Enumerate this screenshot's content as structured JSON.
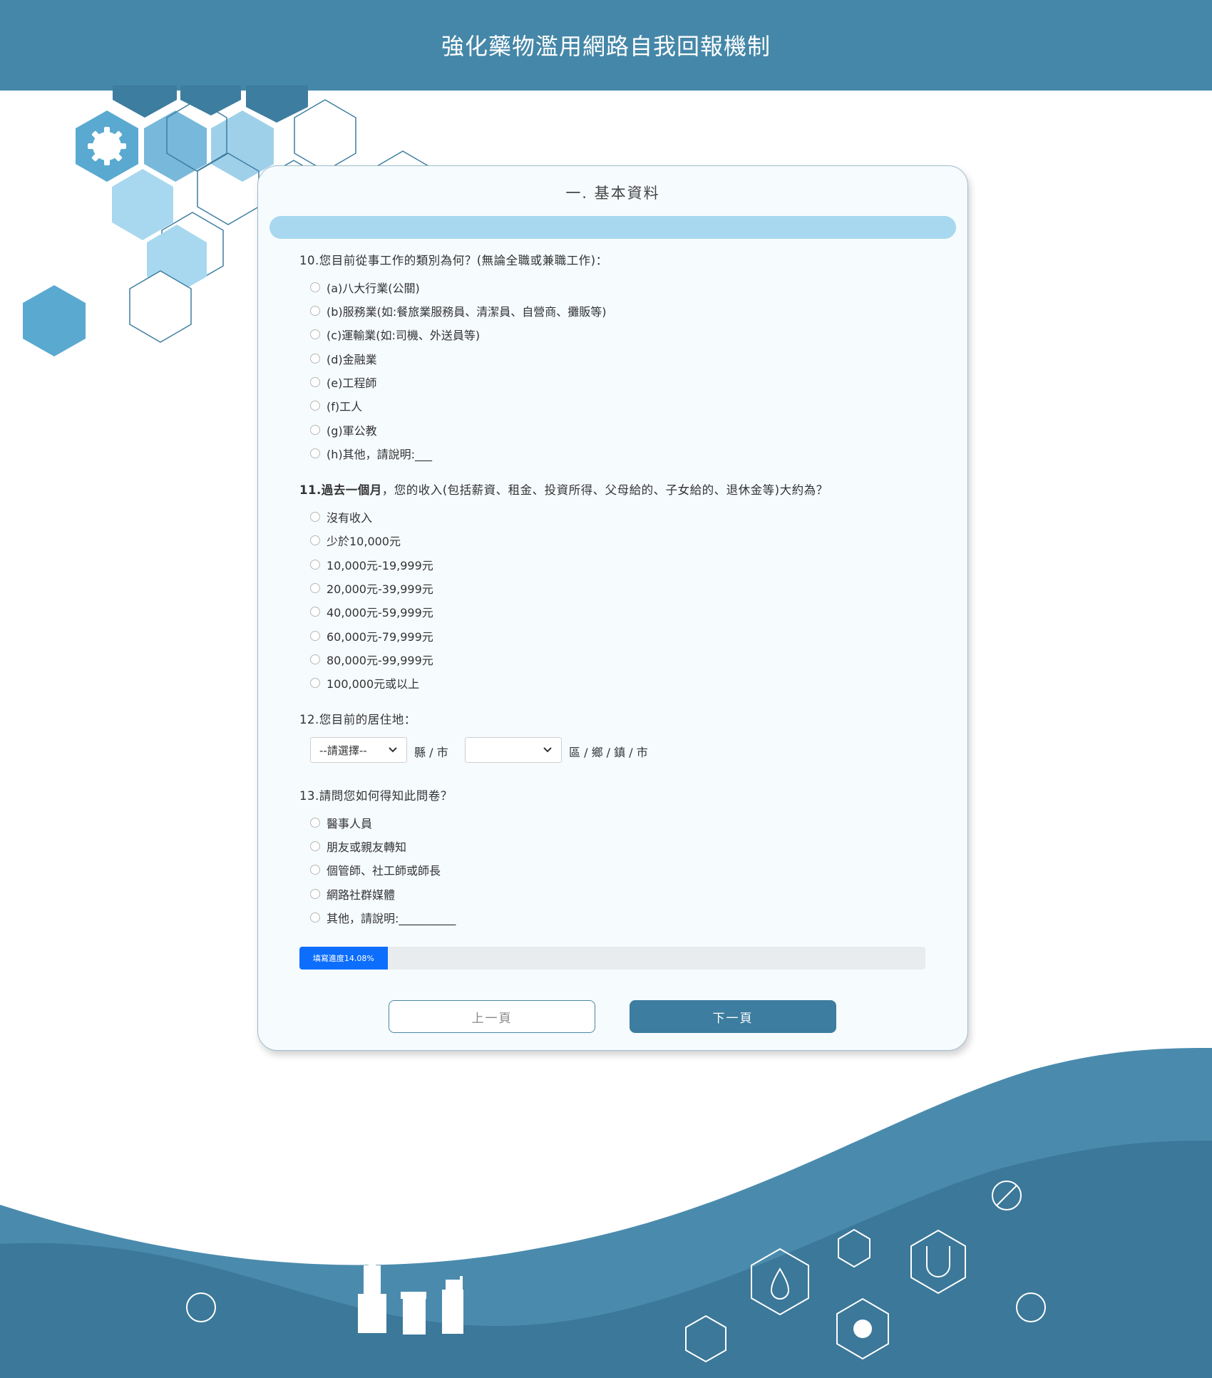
{
  "header": {
    "title": "強化藥物濫用網路自我回報機制"
  },
  "section": {
    "title": "一. 基本資料"
  },
  "q10": {
    "text": "10.您目前從事工作的類別為何？(無論全職或兼職工作)：",
    "options": [
      "(a)八大行業(公關)",
      "(b)服務業(如:餐旅業服務員、清潔員、自營商、攤販等)",
      "(c)運輸業(如:司機、外送員等)",
      "(d)金融業",
      "(e)工程師",
      "(f)工人",
      "(g)軍公教",
      "(h)其他，請說明:___"
    ]
  },
  "q11": {
    "number": "11.",
    "bold": "過去一個月",
    "text": "，您的收入(包括薪資、租金、投資所得、父母給的、子女給的、退休金等)大約為？",
    "options": [
      "沒有收入",
      "少於10,000元",
      "10,000元-19,999元",
      "20,000元-39,999元",
      "40,000元-59,999元",
      "60,000元-79,999元",
      "80,000元-99,999元",
      "100,000元或以上"
    ]
  },
  "q12": {
    "text": "12.您目前的居住地：",
    "county_value": "--請選擇--",
    "county_label": "縣 / 市",
    "district_value": "",
    "district_label": "區 / 鄉 / 鎮 / 市"
  },
  "q13": {
    "text": "13.請問您如何得知此問卷？",
    "options": [
      "醫事人員",
      "朋友或親友轉知",
      "個管師、社工師或師長",
      "網路社群媒體",
      "其他，請說明:__________"
    ]
  },
  "progress": {
    "label": "填寫進度14.08%",
    "percent": 14.08
  },
  "buttons": {
    "prev": "上一頁",
    "next": "下一頁"
  },
  "colors": {
    "header": "#4587a8",
    "accent": "#3d7d9f",
    "progress": "#0d6efd",
    "section_bar": "#a7d8ef"
  }
}
